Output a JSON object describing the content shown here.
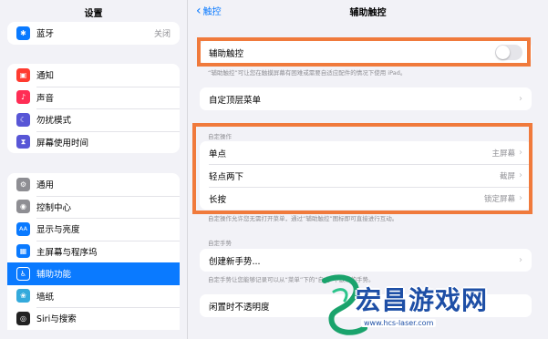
{
  "sidebar": {
    "title": "设置",
    "group1": [
      {
        "label": "蓝牙",
        "value": "关闭",
        "icon": "bluetooth-icon",
        "color": "#0a7aff",
        "glyph": "✱"
      }
    ],
    "group2": [
      {
        "label": "通知",
        "icon": "notification-icon",
        "color": "#ff3b30",
        "glyph": "▣"
      },
      {
        "label": "声音",
        "icon": "sound-icon",
        "color": "#ff2d55",
        "glyph": "♪"
      },
      {
        "label": "勿扰模式",
        "icon": "moon-icon",
        "color": "#5856d6",
        "glyph": "☾"
      },
      {
        "label": "屏幕使用时间",
        "icon": "hourglass-icon",
        "color": "#5856d6",
        "glyph": "⧗"
      }
    ],
    "group3": [
      {
        "label": "通用",
        "icon": "gear-icon",
        "color": "#8e8e93",
        "glyph": "⚙"
      },
      {
        "label": "控制中心",
        "icon": "control-center-icon",
        "color": "#8e8e93",
        "glyph": "◉"
      },
      {
        "label": "显示与亮度",
        "icon": "display-icon",
        "color": "#0a7aff",
        "glyph": "AA"
      },
      {
        "label": "主屏幕与程序坞",
        "icon": "home-screen-icon",
        "color": "#0a7aff",
        "glyph": "▦"
      },
      {
        "label": "辅助功能",
        "icon": "accessibility-icon",
        "color": "#0a7aff",
        "glyph": "♿",
        "selected": true
      },
      {
        "label": "墙纸",
        "icon": "wallpaper-icon",
        "color": "#34aadc",
        "glyph": "❀"
      },
      {
        "label": "Siri与搜索",
        "icon": "siri-icon",
        "color": "#222222",
        "glyph": "◎"
      }
    ]
  },
  "nav": {
    "back_label": "触控",
    "title": "辅助触控"
  },
  "assistive": {
    "label": "辅助触控",
    "enabled": false,
    "note": "“辅助触控”可让您在触摸屏幕有困难或需要自适应配件的情况下使用 iPad。"
  },
  "top_menu": {
    "label": "自定顶层菜单"
  },
  "custom_actions": {
    "header": "自定操作",
    "rows": [
      {
        "label": "单点",
        "value": "主屏幕"
      },
      {
        "label": "轻点两下",
        "value": "截屏"
      },
      {
        "label": "长按",
        "value": "锁定屏幕"
      }
    ],
    "note": "自定操作允许您无需打开菜单，通过“辅助触控”图标即可直接进行互动。"
  },
  "gestures": {
    "header": "自定手势",
    "create_label": "创建新手势...",
    "note": "自定手势让您能够记录可以从“菜单”下的“自定”中激活的手势。"
  },
  "idle": {
    "label": "闲置时不透明度"
  },
  "watermark": {
    "text": "宏昌游戏网",
    "url": "www.hcs-laser.com"
  },
  "colors": {
    "accent": "#0a7aff",
    "highlight": "#f07a3c"
  }
}
